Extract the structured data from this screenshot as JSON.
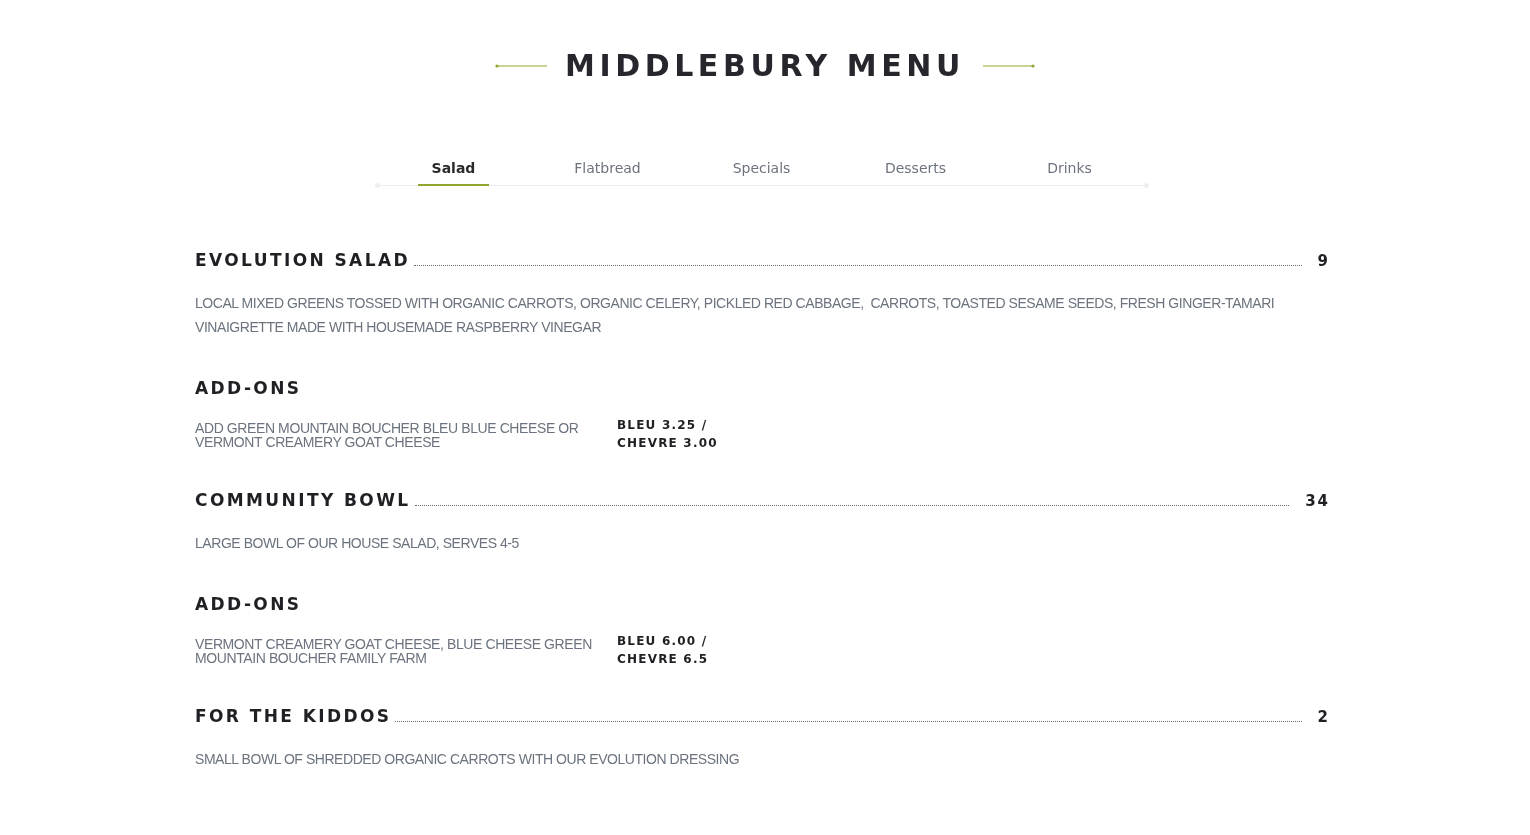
{
  "title": "MIDDLEBURY MENU",
  "tabs": [
    {
      "label": "Salad",
      "selected": true
    },
    {
      "label": "Flatbread",
      "selected": false
    },
    {
      "label": "Specials",
      "selected": false
    },
    {
      "label": "Desserts",
      "selected": false
    },
    {
      "label": "Drinks",
      "selected": false
    }
  ],
  "items": [
    {
      "kind": "dish",
      "name": "EVOLUTION SALAD",
      "price": "9",
      "description": "LOCAL MIXED GREENS TOSSED WITH ORGANIC CARROTS, ORGANIC CELERY, PICKLED RED CABBAGE,  CARROTS, TOASTED SESAME SEEDS, FRESH GINGER-TAMARI VINAIGRETTE MADE WITH HOUSEMADE RASPBERRY VINEGAR"
    },
    {
      "kind": "addons",
      "heading": "ADD-ONS",
      "description": "ADD GREEN MOUNTAIN BOUCHER BLEU BLUE CHEESE OR VERMONT CREAMERY GOAT CHEESE",
      "price": "BLEU 3.25 / CHEVRE 3.00"
    },
    {
      "kind": "dish",
      "name": "COMMUNITY BOWL",
      "price": "34",
      "description": "LARGE BOWL OF OUR HOUSE SALAD, SERVES 4-5"
    },
    {
      "kind": "addons",
      "heading": "ADD-ONS",
      "description": "VERMONT CREAMERY GOAT CHEESE, BLUE CHEESE GREEN MOUNTAIN BOUCHER FAMILY FARM",
      "price": "BLEU 6.00 / CHEVRE 6.5"
    },
    {
      "kind": "dish",
      "name": "FOR THE KIDDOS",
      "price": "2",
      "description": "SMALL BOWL OF SHREDDED ORGANIC CARROTS WITH OUR EVOLUTION DRESSING"
    }
  ]
}
